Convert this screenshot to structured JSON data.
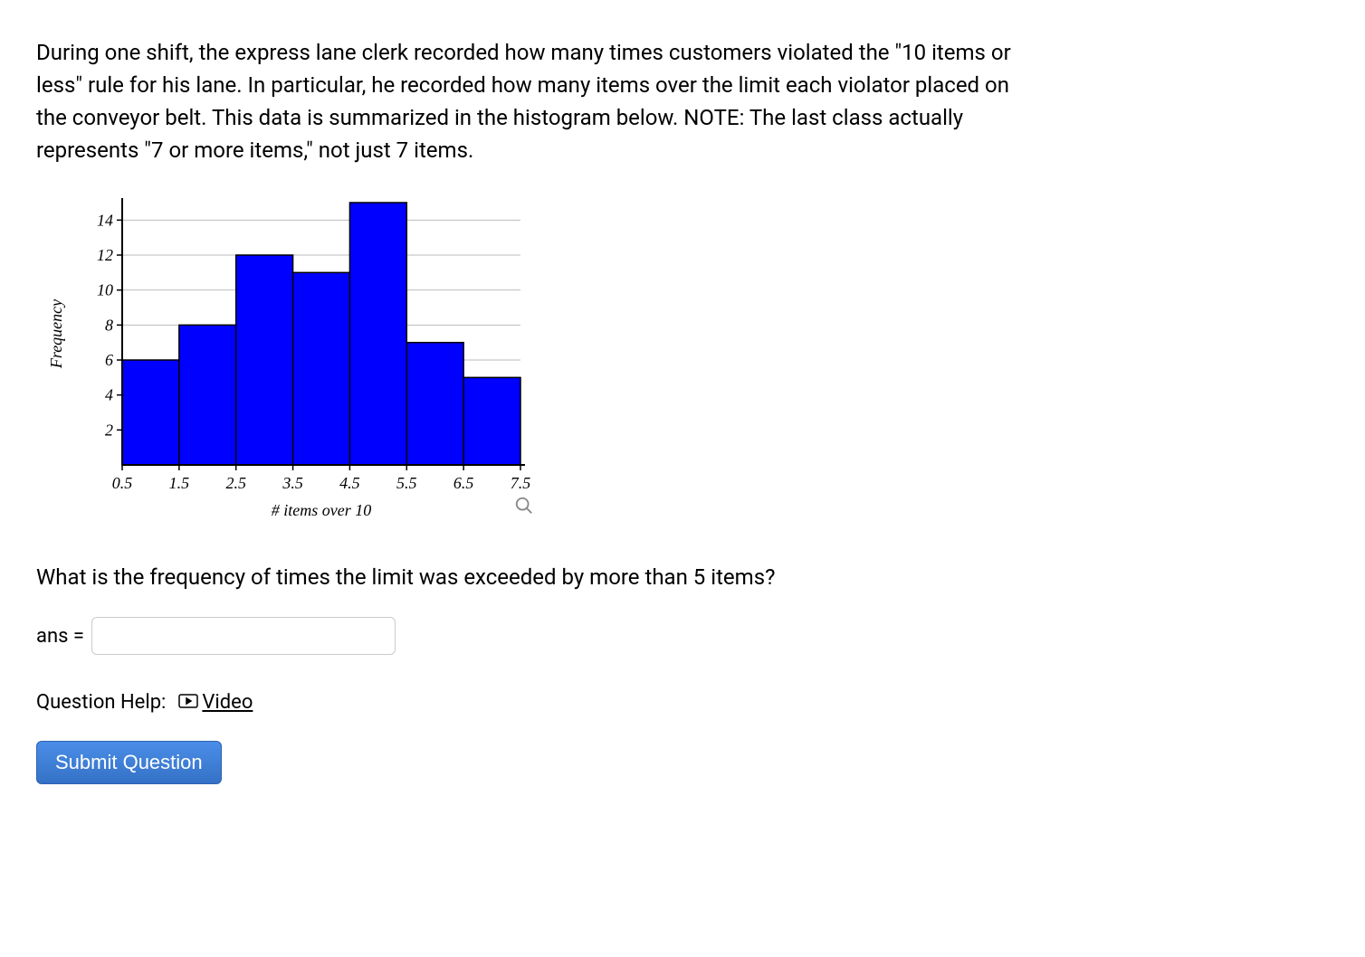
{
  "problem_text": "During one shift, the express lane clerk recorded how many times customers violated the \"10 items or less\" rule for his lane. In particular, he recorded how many items over the limit each violator placed on the conveyor belt. This data is summarized in the histogram below. NOTE: The last class actually represents \"7 or more items,\" not just 7 items.",
  "question_text": "What is the frequency of times the limit was exceeded by more than 5 items?",
  "answer": {
    "label": "ans =",
    "value": "",
    "placeholder": ""
  },
  "help": {
    "label": "Question Help:",
    "video_label": "Video"
  },
  "submit_label": "Submit Question",
  "chart_data": {
    "type": "bar",
    "title": "",
    "xlabel": "# items over 10",
    "ylabel": "Frequency",
    "x_ticks": [
      "0.5",
      "1.5",
      "2.5",
      "3.5",
      "4.5",
      "5.5",
      "6.5",
      "7.5"
    ],
    "y_ticks": [
      2,
      4,
      6,
      8,
      10,
      12,
      14
    ],
    "ylim": [
      0,
      15
    ],
    "categories": [
      "1",
      "2",
      "3",
      "4",
      "5",
      "6",
      "7"
    ],
    "bin_edges": [
      0.5,
      1.5,
      2.5,
      3.5,
      4.5,
      5.5,
      6.5,
      7.5
    ],
    "values": [
      6,
      8,
      12,
      11,
      15,
      7,
      5
    ],
    "bar_color": "#0000ff",
    "grid": true
  }
}
